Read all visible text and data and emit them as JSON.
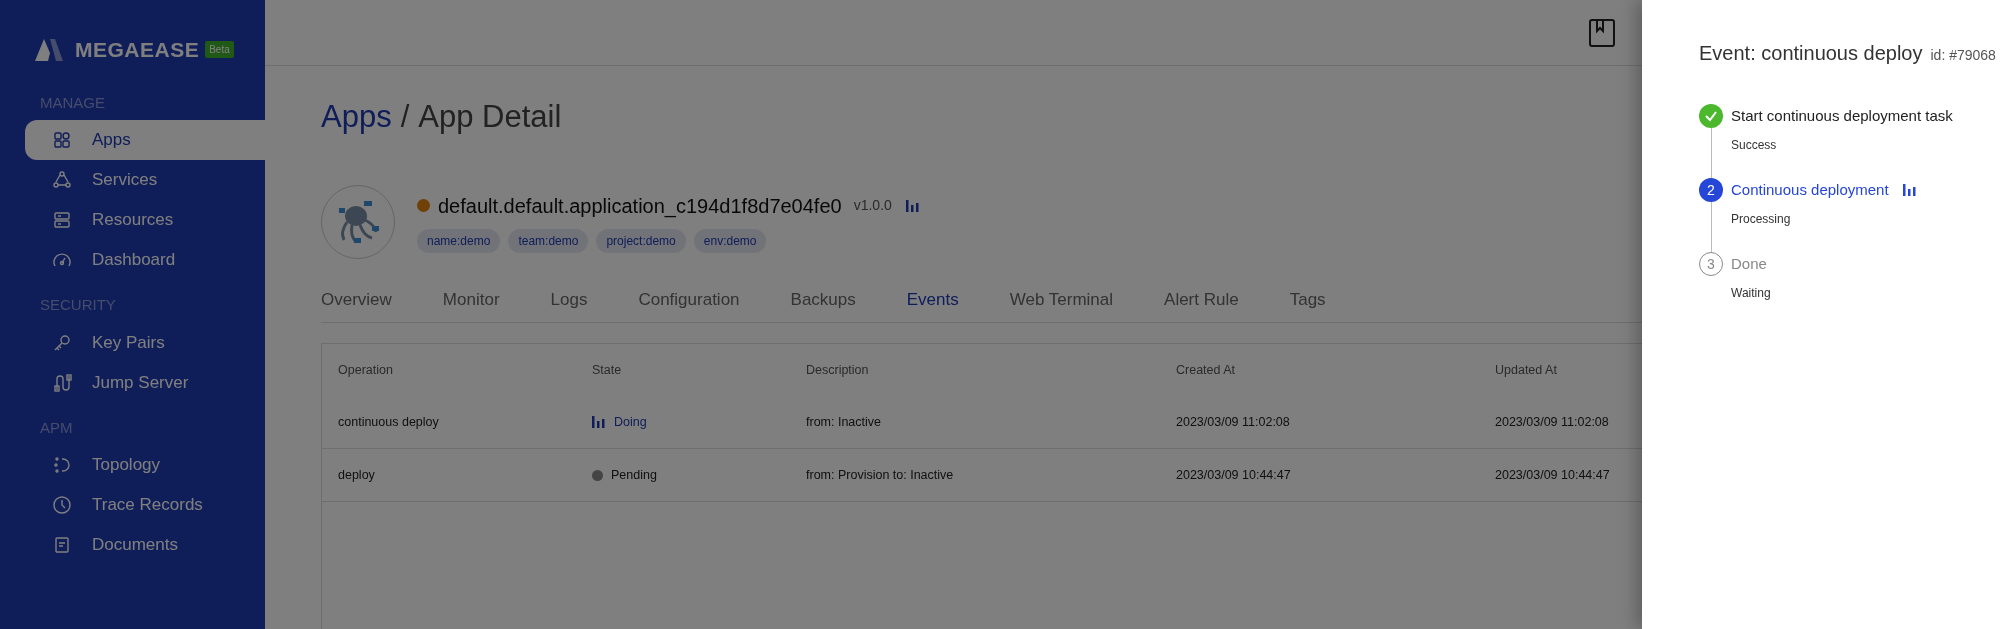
{
  "sidebar": {
    "brand": "MEGAEASE",
    "badge": "Beta",
    "sections": [
      {
        "title": "MANAGE",
        "items": [
          {
            "label": "Apps",
            "selected": true
          },
          {
            "label": "Services",
            "selected": false
          },
          {
            "label": "Resources",
            "selected": false
          },
          {
            "label": "Dashboard",
            "selected": false
          }
        ]
      },
      {
        "title": "SECURITY",
        "items": [
          {
            "label": "Key Pairs",
            "selected": false
          },
          {
            "label": "Jump Server",
            "selected": false
          }
        ]
      },
      {
        "title": "APM",
        "items": [
          {
            "label": "Topology",
            "selected": false
          },
          {
            "label": "Trace Records",
            "selected": false
          },
          {
            "label": "Documents",
            "selected": false
          }
        ]
      }
    ]
  },
  "breadcrumb": {
    "items": [
      {
        "label": "Apps"
      },
      {
        "label": "App Detail"
      }
    ],
    "separator": "/"
  },
  "app": {
    "name": "default.default.application_c194d1f8d7e04fe0",
    "version": "v1.0.0",
    "tags": [
      "name:demo",
      "team:demo",
      "project:demo",
      "env:demo"
    ]
  },
  "tabs": [
    {
      "label": "Overview",
      "selected": false
    },
    {
      "label": "Monitor",
      "selected": false
    },
    {
      "label": "Logs",
      "selected": false
    },
    {
      "label": "Configuration",
      "selected": false
    },
    {
      "label": "Backups",
      "selected": false
    },
    {
      "label": "Events",
      "selected": true
    },
    {
      "label": "Web Terminal",
      "selected": false
    },
    {
      "label": "Alert Rule",
      "selected": false
    },
    {
      "label": "Tags",
      "selected": false
    }
  ],
  "table": {
    "columns": [
      "Operation",
      "State",
      "Description",
      "Created At",
      "Updated At"
    ],
    "rows": [
      {
        "operation": "continuous deploy",
        "state": {
          "kind": "doing",
          "label": "Doing"
        },
        "description": "from: Inactive",
        "created": "2023/03/09 11:02:08",
        "updated": "2023/03/09 11:02:08"
      },
      {
        "operation": "deploy",
        "state": {
          "kind": "pending",
          "label": "Pending"
        },
        "description": "from: Provision to: Inactive",
        "created": "2023/03/09 10:44:47",
        "updated": "2023/03/09 10:44:47"
      }
    ]
  },
  "drawer": {
    "title": "Event: continuous deploy",
    "id": "id: #79068",
    "steps": [
      {
        "kind": "finish",
        "title": "Start continuous deployment task",
        "detail": "Success"
      },
      {
        "kind": "process",
        "number": "2",
        "title": "Continuous deployment",
        "detail": "Processing"
      },
      {
        "kind": "wait",
        "number": "3",
        "title": "Done",
        "detail": "Waiting"
      }
    ]
  }
}
